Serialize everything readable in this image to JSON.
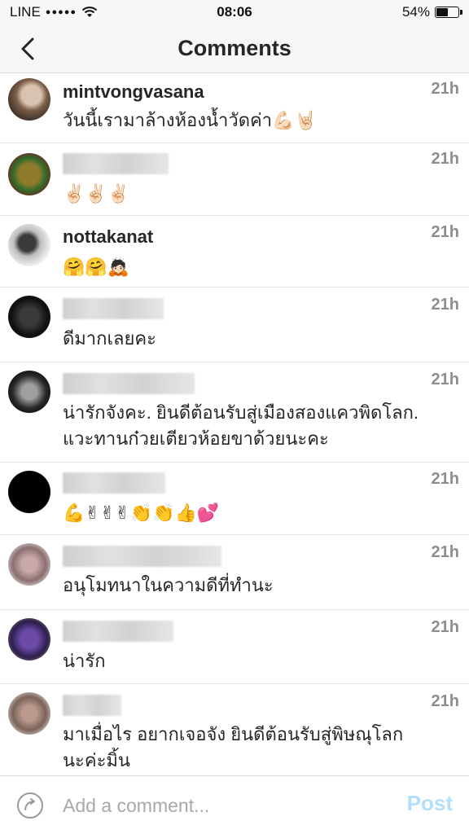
{
  "status_bar": {
    "carrier": "LINE",
    "signal": "●●●●●",
    "time": "08:06",
    "battery_percent_label": "54%",
    "battery_level": 0.54
  },
  "nav": {
    "title": "Comments",
    "back_icon": "chevron-left-icon"
  },
  "comments": [
    {
      "username": "mintvongvasana",
      "text": "วันนี้เรามาล้างห้องน้ำวัดค่า💪🏻🤘🏻",
      "time": "21h"
    },
    {
      "username": "",
      "text": "✌🏻✌🏻✌🏻",
      "time": "21h"
    },
    {
      "username": "nottakanat",
      "text": "🤗🤗🙇🏻",
      "time": "21h"
    },
    {
      "username": "",
      "text": "ดีมากเลยคะ",
      "time": "21h"
    },
    {
      "username": "",
      "text": "น่ารักจังคะ. ยินดีต้อนรับสู่เมืองสองแควพิดโลก. แวะทานก๋วยเตียวห้อยขาด้วยนะคะ",
      "time": "21h"
    },
    {
      "username": "",
      "text": "💪✌✌✌👏👏👍💕",
      "time": "21h"
    },
    {
      "username": "",
      "text": "อนุโมทนาในความดีที่ทำนะ",
      "time": "21h"
    },
    {
      "username": "",
      "text": "น่ารัก",
      "time": "21h"
    },
    {
      "username": "",
      "text": "มาเมื่อไร อยากเจอจัง ยินดีต้อนรับสู่พิษณุโลกนะค่ะมิ้น",
      "time": "21h"
    }
  ],
  "composer": {
    "placeholder": "Add a comment...",
    "post_label": "Post",
    "reply_icon": "reply-icon"
  },
  "colors": {
    "post_disabled": "#b2dffc",
    "timestamp": "#8e8e8e"
  }
}
